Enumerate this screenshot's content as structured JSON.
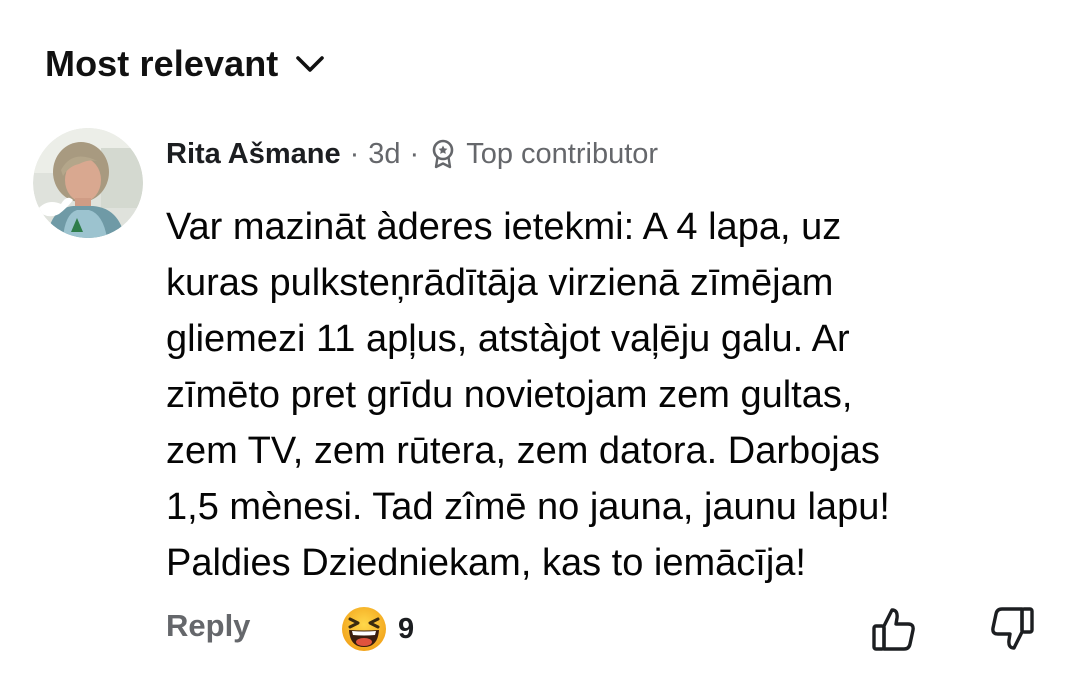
{
  "sort": {
    "label": "Most relevant",
    "icon": "chevron-down-icon"
  },
  "comment": {
    "author": "Rita Ašmane",
    "separator": "·",
    "time": "3d",
    "badge": {
      "icon": "top-contributor-badge-icon",
      "label": "Top contributor"
    },
    "text": "Var mazināt àderes ietekmi: A 4 lapa, uz\nkuras pulksteņrādītāja virzienā zīmējam\ngliemezi 11 apļus, atstàjot vaļēju galu. Ar\nzīmēto pret grīdu novietojam zem gultas,\nzem TV, zem rūtera, zem datora. Darbojas\n1,5 mènesi. Tad zîmē no jauna, jaunu lapu!\nPaldies Dziedniekam, kas to iemācīja!"
  },
  "actions": {
    "reply_label": "Reply",
    "reaction_icon": "laughing-emoji-icon",
    "reaction_count": "9",
    "like_icon": "thumbs-up-icon",
    "dislike_icon": "thumbs-down-icon"
  },
  "colors": {
    "primary_text": "#050505",
    "secondary_text": "#65676b",
    "emoji_yellow": "#f7b125"
  }
}
